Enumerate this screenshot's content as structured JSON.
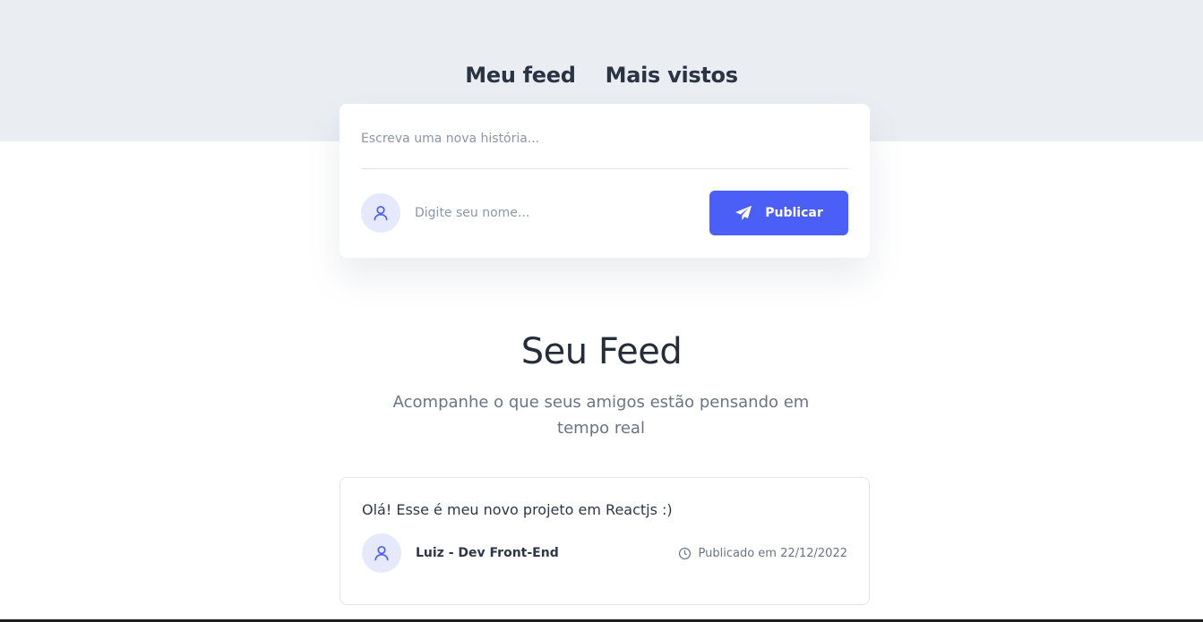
{
  "nav": {
    "tabs": [
      {
        "label": "Meu feed"
      },
      {
        "label": "Mais vistos"
      }
    ]
  },
  "composer": {
    "story_placeholder": "Escreva uma nova história...",
    "name_placeholder": "Digite seu nome...",
    "publish_label": "Publicar",
    "avatar_icon": "user-icon",
    "publish_icon": "send-icon"
  },
  "feed": {
    "title": "Seu Feed",
    "subtitle": "Acompanhe o que seus amigos estão pensando em tempo real"
  },
  "posts": [
    {
      "text": "Olá! Esse é meu novo projeto em Reactjs :)",
      "author": "Luiz - Dev Front-End",
      "date": "Publicado em 22/12/2022",
      "avatar_icon": "user-icon",
      "date_icon": "clock-icon"
    }
  ],
  "colors": {
    "accent": "#4b5ef5",
    "avatar_bg": "#e6e9fb",
    "band_bg": "#eaeef3"
  }
}
